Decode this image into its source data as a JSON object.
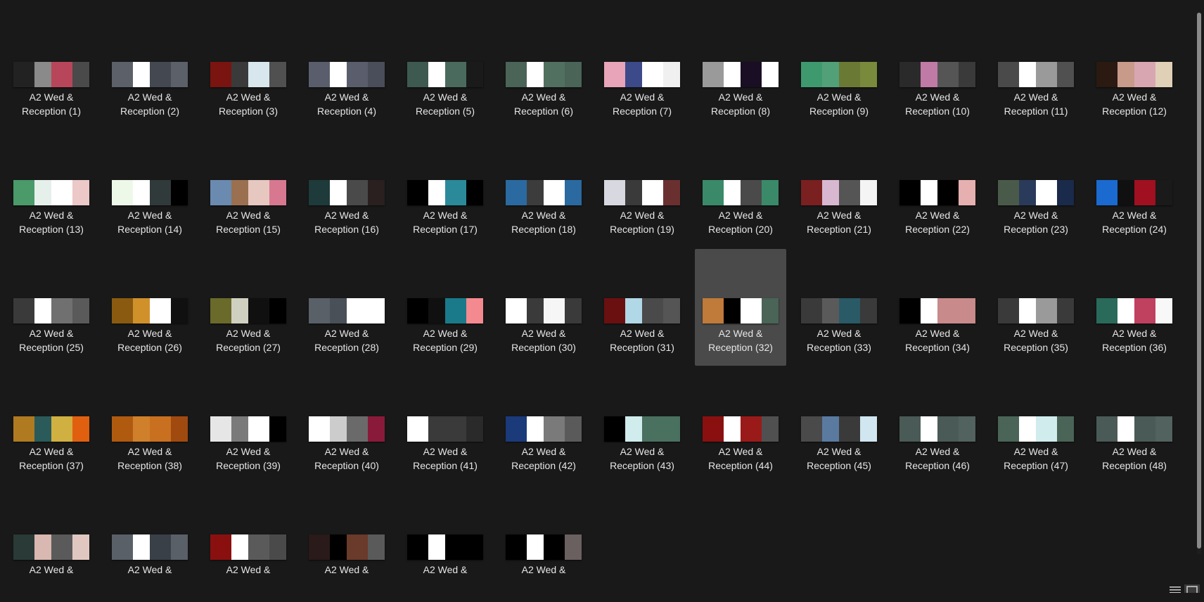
{
  "window": {
    "view_buttons": [
      {
        "icon": "details-view-icon"
      },
      {
        "icon": "large-icons-view-icon"
      }
    ]
  },
  "files": [
    {
      "line1": "A2 Wed &",
      "line2": "Reception (1)",
      "colors": [
        "#222222",
        "#8a8a8a",
        "#b8465a",
        "#4a4a4a"
      ]
    },
    {
      "line1": "A2 Wed &",
      "line2": "Reception (2)",
      "colors": [
        "#5c6068",
        "#ffffff",
        "#444850",
        "#5c6068"
      ]
    },
    {
      "line1": "A2 Wed &",
      "line2": "Reception (3)",
      "colors": [
        "#7a1410",
        "#3a3a3a",
        "#d8e6ee",
        "#505050"
      ]
    },
    {
      "line1": "A2 Wed &",
      "line2": "Reception (4)",
      "colors": [
        "#5a5e6c",
        "#ffffff",
        "#5a5e6c",
        "#4a4e5a"
      ]
    },
    {
      "line1": "A2 Wed &",
      "line2": "Reception (5)",
      "colors": [
        "#3e5a50",
        "#ffffff",
        "#4a6a5e",
        "#1a1a1a"
      ]
    },
    {
      "line1": "A2 Wed &",
      "line2": "Reception (6)",
      "colors": [
        "#4a6458",
        "#ffffff",
        "#52705f",
        "#4a6458"
      ]
    },
    {
      "line1": "A2 Wed &",
      "line2": "Reception (7)",
      "colors": [
        "#e8a4b8",
        "#3c4a8a",
        "#ffffff",
        "#f0f0f0"
      ]
    },
    {
      "line1": "A2 Wed &",
      "line2": "Reception (8)",
      "colors": [
        "#9a9a9a",
        "#ffffff",
        "#1a0e24",
        "#ffffff"
      ]
    },
    {
      "line1": "A2 Wed &",
      "line2": "Reception (9)",
      "colors": [
        "#3e9a6e",
        "#52a078",
        "#6a7a34",
        "#7a8a3c"
      ]
    },
    {
      "line1": "A2 Wed &",
      "line2": "Reception (10)",
      "colors": [
        "#2a2a2a",
        "#c07aa6",
        "#555555",
        "#3a3a3a"
      ]
    },
    {
      "line1": "A2 Wed &",
      "line2": "Reception (11)",
      "colors": [
        "#4a4a4a",
        "#ffffff",
        "#9a9a9a",
        "#505050"
      ]
    },
    {
      "line1": "A2 Wed &",
      "line2": "Reception (12)",
      "colors": [
        "#2a1a12",
        "#c89a8a",
        "#d8a6b0",
        "#e0d0b8"
      ]
    },
    {
      "line1": "A2 Wed &",
      "line2": "Reception (13)",
      "colors": [
        "#4a9a6a",
        "#e6f0ea",
        "#ffffff",
        "#ecc8c8"
      ]
    },
    {
      "line1": "A2 Wed &",
      "line2": "Reception (14)",
      "colors": [
        "#eef8e8",
        "#ffffff",
        "#303a3a",
        "#000000"
      ]
    },
    {
      "line1": "A2 Wed &",
      "line2": "Reception (15)",
      "colors": [
        "#6a8ab0",
        "#9a7050",
        "#e6c8c0",
        "#d87890"
      ]
    },
    {
      "line1": "A2 Wed &",
      "line2": "Reception (16)",
      "colors": [
        "#1e3a3a",
        "#ffffff",
        "#4a4a4a",
        "#2a2020"
      ]
    },
    {
      "line1": "A2 Wed &",
      "line2": "Reception (17)",
      "colors": [
        "#000000",
        "#ffffff",
        "#2a8a9a",
        "#000000"
      ]
    },
    {
      "line1": "A2 Wed &",
      "line2": "Reception (18)",
      "colors": [
        "#2a6aa0",
        "#3c3c3c",
        "#ffffff",
        "#2a6aa0"
      ]
    },
    {
      "line1": "A2 Wed &",
      "line2": "Reception (19)",
      "colors": [
        "#d8d8e0",
        "#3a3a3a",
        "#ffffff",
        "#6a3030"
      ]
    },
    {
      "line1": "A2 Wed &",
      "line2": "Reception (20)",
      "colors": [
        "#3a8a6a",
        "#ffffff",
        "#4a4a4a",
        "#3a8a6a"
      ]
    },
    {
      "line1": "A2 Wed &",
      "line2": "Reception (21)",
      "colors": [
        "#7a2020",
        "#d8b8d0",
        "#555555",
        "#f4f4f4"
      ]
    },
    {
      "line1": "A2 Wed &",
      "line2": "Reception (22)",
      "colors": [
        "#000000",
        "#ffffff",
        "#000000",
        "#e6b0b0"
      ]
    },
    {
      "line1": "A2 Wed &",
      "line2": "Reception (23)",
      "colors": [
        "#4a5a4a",
        "#2a3a5a",
        "#ffffff",
        "#1a2a4a"
      ]
    },
    {
      "line1": "A2 Wed &",
      "line2": "Reception (24)",
      "colors": [
        "#1a6ad0",
        "#101010",
        "#a01020",
        "#1a1a1a"
      ]
    },
    {
      "line1": "A2 Wed &",
      "line2": "Reception (25)",
      "colors": [
        "#3a3a3a",
        "#ffffff",
        "#707070",
        "#5a5a5a"
      ]
    },
    {
      "line1": "A2 Wed &",
      "line2": "Reception (26)",
      "colors": [
        "#8a5a10",
        "#d0902a",
        "#ffffff",
        "#101010"
      ]
    },
    {
      "line1": "A2 Wed &",
      "line2": "Reception (27)",
      "colors": [
        "#6a6a2a",
        "#d0d0c0",
        "#101010",
        "#000000"
      ]
    },
    {
      "line1": "A2 Wed &",
      "line2": "Reception (28)",
      "colors": [
        "#5a6068",
        "#4a5058",
        "#ffffff",
        "#ffffff"
      ]
    },
    {
      "line1": "A2 Wed &",
      "line2": "Reception (29)",
      "colors": [
        "#000000",
        "#101010",
        "#1a7a8a",
        "#f48a90"
      ]
    },
    {
      "line1": "A2 Wed &",
      "line2": "Reception (30)",
      "colors": [
        "#ffffff",
        "#3a3a3a",
        "#f6f6f6",
        "#3a3a3a"
      ]
    },
    {
      "line1": "A2 Wed &",
      "line2": "Reception (31)",
      "colors": [
        "#6a1010",
        "#b0d8e6",
        "#4a4a4a",
        "#555555"
      ]
    },
    {
      "line1": "A2 Wed &",
      "line2": "Reception (32)",
      "colors": [
        "#c07a3a",
        "#000000",
        "#ffffff",
        "#4a6458"
      ]
    },
    {
      "line1": "A2 Wed &",
      "line2": "Reception (33)",
      "colors": [
        "#3a3a3a",
        "#5a5a5a",
        "#2a5a66",
        "#3a3a3a"
      ]
    },
    {
      "line1": "A2 Wed &",
      "line2": "Reception (34)",
      "colors": [
        "#000000",
        "#ffffff",
        "#c88a8a",
        "#c88a8a"
      ]
    },
    {
      "line1": "A2 Wed &",
      "line2": "Reception (35)",
      "colors": [
        "#3a3a3a",
        "#ffffff",
        "#9a9a9a",
        "#3a3a3a"
      ]
    },
    {
      "line1": "A2 Wed &",
      "line2": "Reception (36)",
      "colors": [
        "#2a6a5a",
        "#ffffff",
        "#c04060",
        "#f8f8f8"
      ]
    },
    {
      "line1": "A2 Wed &",
      "line2": "Reception (37)",
      "colors": [
        "#b07a20",
        "#2a5a5a",
        "#d0b040",
        "#e06010"
      ]
    },
    {
      "line1": "A2 Wed &",
      "line2": "Reception (38)",
      "colors": [
        "#b05a10",
        "#d0802a",
        "#c87020",
        "#a04a10"
      ]
    },
    {
      "line1": "A2 Wed &",
      "line2": "Reception (39)",
      "colors": [
        "#e6e6e6",
        "#7a7a7a",
        "#ffffff",
        "#000000"
      ]
    },
    {
      "line1": "A2 Wed &",
      "line2": "Reception (40)",
      "colors": [
        "#ffffff",
        "#cccccc",
        "#6a6a6a",
        "#8a1a3a"
      ]
    },
    {
      "line1": "A2 Wed &",
      "line2": "Reception (41)",
      "colors": [
        "#ffffff",
        "#3a3a3a",
        "#3a3a3a",
        "#2a2a2a"
      ]
    },
    {
      "line1": "A2 Wed &",
      "line2": "Reception (42)",
      "colors": [
        "#1a3a7a",
        "#ffffff",
        "#7a7a7a",
        "#5a5a5a"
      ]
    },
    {
      "line1": "A2 Wed &",
      "line2": "Reception (43)",
      "colors": [
        "#000000",
        "#d0ecec",
        "#4a7060",
        "#4a7060"
      ]
    },
    {
      "line1": "A2 Wed &",
      "line2": "Reception (44)",
      "colors": [
        "#8a1010",
        "#ffffff",
        "#9a1a1a",
        "#505050"
      ]
    },
    {
      "line1": "A2 Wed &",
      "line2": "Reception (45)",
      "colors": [
        "#4a4a4a",
        "#5a7aa0",
        "#3a3a3a",
        "#d0e6f0"
      ]
    },
    {
      "line1": "A2 Wed &",
      "line2": "Reception (46)",
      "colors": [
        "#4a5a56",
        "#ffffff",
        "#4a5a56",
        "#52625e"
      ]
    },
    {
      "line1": "A2 Wed &",
      "line2": "Reception (47)",
      "colors": [
        "#4a6458",
        "#ffffff",
        "#d0ecec",
        "#4a6458"
      ]
    },
    {
      "line1": "A2 Wed &",
      "line2": "Reception (48)",
      "colors": [
        "#4a5a56",
        "#ffffff",
        "#4a5a56",
        "#52625e"
      ]
    },
    {
      "line1": "A2 Wed &",
      "line2": "",
      "colors": [
        "#2a3a36",
        "#d8b8b0",
        "#5a5a5a",
        "#e0c8c0"
      ]
    },
    {
      "line1": "A2 Wed &",
      "line2": "",
      "colors": [
        "#5a6068",
        "#ffffff",
        "#3a4048",
        "#5a6068"
      ]
    },
    {
      "line1": "A2 Wed &",
      "line2": "",
      "colors": [
        "#8a1010",
        "#ffffff",
        "#5a5a5a",
        "#4a4a4a"
      ]
    },
    {
      "line1": "A2 Wed &",
      "line2": "",
      "colors": [
        "#2a1a1a",
        "#000000",
        "#6a3a2a",
        "#5a5a5a"
      ]
    },
    {
      "line1": "A2 Wed &",
      "line2": "",
      "colors": [
        "#000000",
        "#ffffff",
        "#000000",
        "#000000"
      ]
    },
    {
      "line1": "A2 Wed &",
      "line2": "",
      "colors": [
        "#000000",
        "#ffffff",
        "#000000",
        "#6a6060"
      ]
    }
  ],
  "selected_index": 31,
  "scrollbar_fraction": 0.99
}
